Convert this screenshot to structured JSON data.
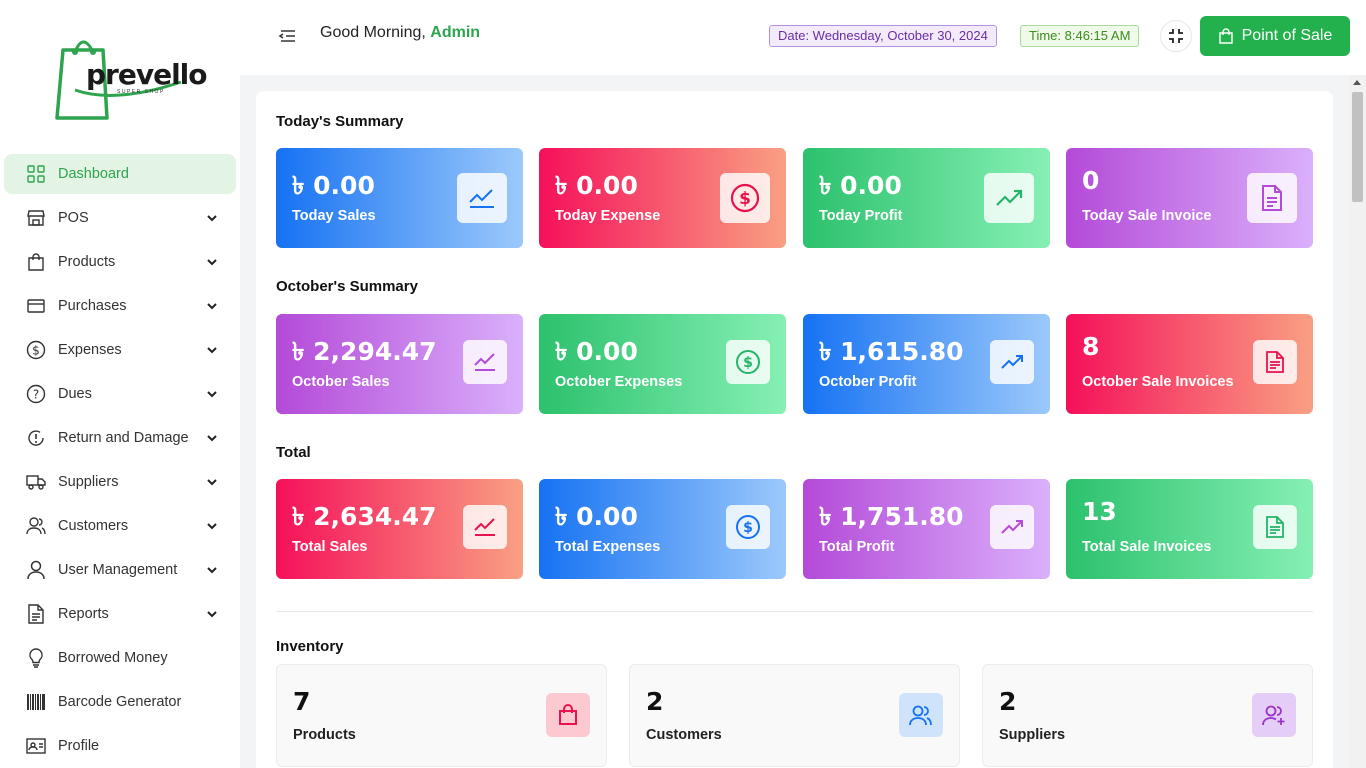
{
  "brand": {
    "name": "prevello",
    "tagline": "SUPER SHOP",
    "color": "#2ea44f"
  },
  "sidebar": {
    "items": [
      {
        "label": "Dashboard",
        "icon": "dashboard-icon",
        "active": true,
        "has_children": false
      },
      {
        "label": "POS",
        "icon": "store-icon",
        "has_children": true
      },
      {
        "label": "Products",
        "icon": "shopping-bag-icon",
        "has_children": true
      },
      {
        "label": "Purchases",
        "icon": "credit-card-icon",
        "has_children": true
      },
      {
        "label": "Expenses",
        "icon": "dollar-circle-icon",
        "has_children": true
      },
      {
        "label": "Dues",
        "icon": "question-circle-icon",
        "has_children": true
      },
      {
        "label": "Return and Damage",
        "icon": "return-alert-icon",
        "has_children": true
      },
      {
        "label": "Suppliers",
        "icon": "truck-icon",
        "has_children": true
      },
      {
        "label": "Customers",
        "icon": "users-icon",
        "has_children": true
      },
      {
        "label": "User Management",
        "icon": "user-icon",
        "has_children": true
      },
      {
        "label": "Reports",
        "icon": "report-icon",
        "has_children": true
      },
      {
        "label": "Borrowed Money",
        "icon": "bulb-icon",
        "has_children": false
      },
      {
        "label": "Barcode Generator",
        "icon": "barcode-icon",
        "has_children": false
      },
      {
        "label": "Profile",
        "icon": "id-card-icon",
        "has_children": false
      }
    ]
  },
  "header": {
    "greeting": "Good Morning, ",
    "user": "Admin",
    "date": "Date: Wednesday, October 30, 2024",
    "time": "Time: 8:46:15 AM",
    "pos_button": "Point of Sale"
  },
  "sections": {
    "today": {
      "title": "Today's Summary",
      "cards": [
        {
          "value": "৳ 0.00",
          "label": "Today Sales",
          "icon": "chart-line-icon"
        },
        {
          "value": "৳ 0.00",
          "label": "Today Expense",
          "icon": "dollar-circle-icon"
        },
        {
          "value": "৳ 0.00",
          "label": "Today Profit",
          "icon": "trending-up-icon"
        },
        {
          "value": "0",
          "label": "Today Sale Invoice",
          "icon": "invoice-icon"
        }
      ]
    },
    "month": {
      "title": "October's Summary",
      "cards": [
        {
          "value": "৳ 2,294.47",
          "label": "October Sales",
          "icon": "chart-line-icon"
        },
        {
          "value": "৳ 0.00",
          "label": "October Expenses",
          "icon": "dollar-circle-icon"
        },
        {
          "value": "৳ 1,615.80",
          "label": "October Profit",
          "icon": "trending-up-icon"
        },
        {
          "value": "8",
          "label": "October Sale Invoices",
          "icon": "invoice-icon"
        }
      ]
    },
    "total": {
      "title": "Total",
      "cards": [
        {
          "value": "৳ 2,634.47",
          "label": "Total Sales",
          "icon": "chart-line-icon"
        },
        {
          "value": "৳ 0.00",
          "label": "Total Expenses",
          "icon": "dollar-circle-icon"
        },
        {
          "value": "৳ 1,751.80",
          "label": "Total Profit",
          "icon": "trending-up-icon"
        },
        {
          "value": "13",
          "label": "Total Sale Invoices",
          "icon": "invoice-icon"
        }
      ]
    },
    "inventory": {
      "title": "Inventory",
      "cards": [
        {
          "value": "7",
          "label": "Products",
          "icon": "shopping-bag-icon"
        },
        {
          "value": "2",
          "label": "Customers",
          "icon": "users-icon"
        },
        {
          "value": "2",
          "label": "Suppliers",
          "icon": "user-add-icon"
        }
      ]
    }
  },
  "colors": {
    "blue": "#1672f3",
    "red": "#f5105a",
    "green": "#2cc16d",
    "purple": "#b44ad8",
    "accent": "#22b14c"
  }
}
